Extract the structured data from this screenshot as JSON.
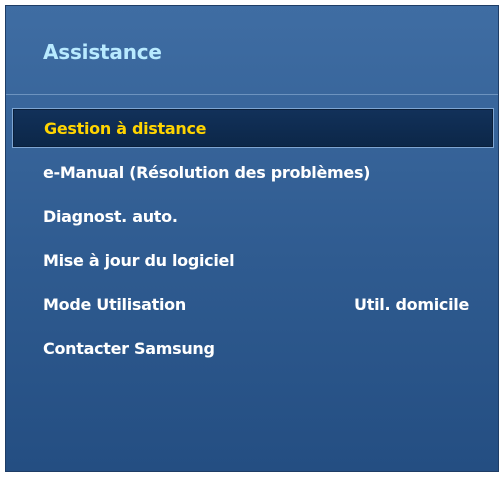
{
  "menu": {
    "title": "Assistance",
    "items": [
      {
        "label": "Gestion à distance",
        "selected": true
      },
      {
        "label": "e-Manual (Résolution des problèmes)"
      },
      {
        "label": "Diagnost. auto."
      },
      {
        "label": "Mise à jour du logiciel"
      },
      {
        "label": "Mode Utilisation",
        "value": "Util. domicile"
      },
      {
        "label": "Contacter Samsung"
      }
    ]
  },
  "colors": {
    "panel_background": "#315e94",
    "title_text": "#b8eaff",
    "item_text": "#ffffff",
    "selected_text": "#ffd400",
    "selected_background": "#0f2c52"
  }
}
